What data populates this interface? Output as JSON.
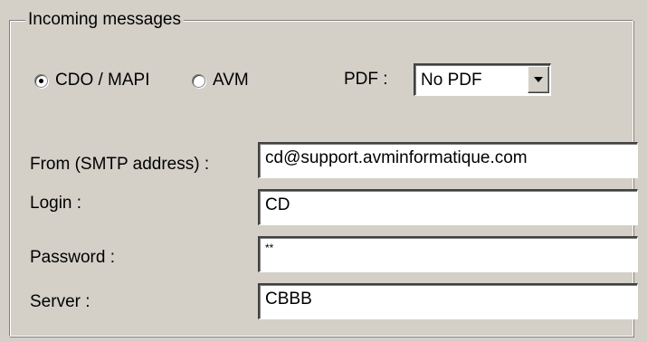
{
  "group": {
    "title": "Incoming messages"
  },
  "protocol": {
    "options": [
      {
        "label": "CDO / MAPI",
        "checked": true
      },
      {
        "label": "AVM",
        "checked": false
      }
    ]
  },
  "pdf": {
    "label": "PDF :",
    "selected": "No PDF"
  },
  "fields": {
    "from": {
      "label": "From (SMTP address) :",
      "value": "cd@support.avminformatique.com"
    },
    "login": {
      "label": "Login :",
      "value": "CD"
    },
    "password": {
      "label": "Password :",
      "value": "**"
    },
    "server": {
      "label": "Server :",
      "value": "CBBB"
    }
  }
}
